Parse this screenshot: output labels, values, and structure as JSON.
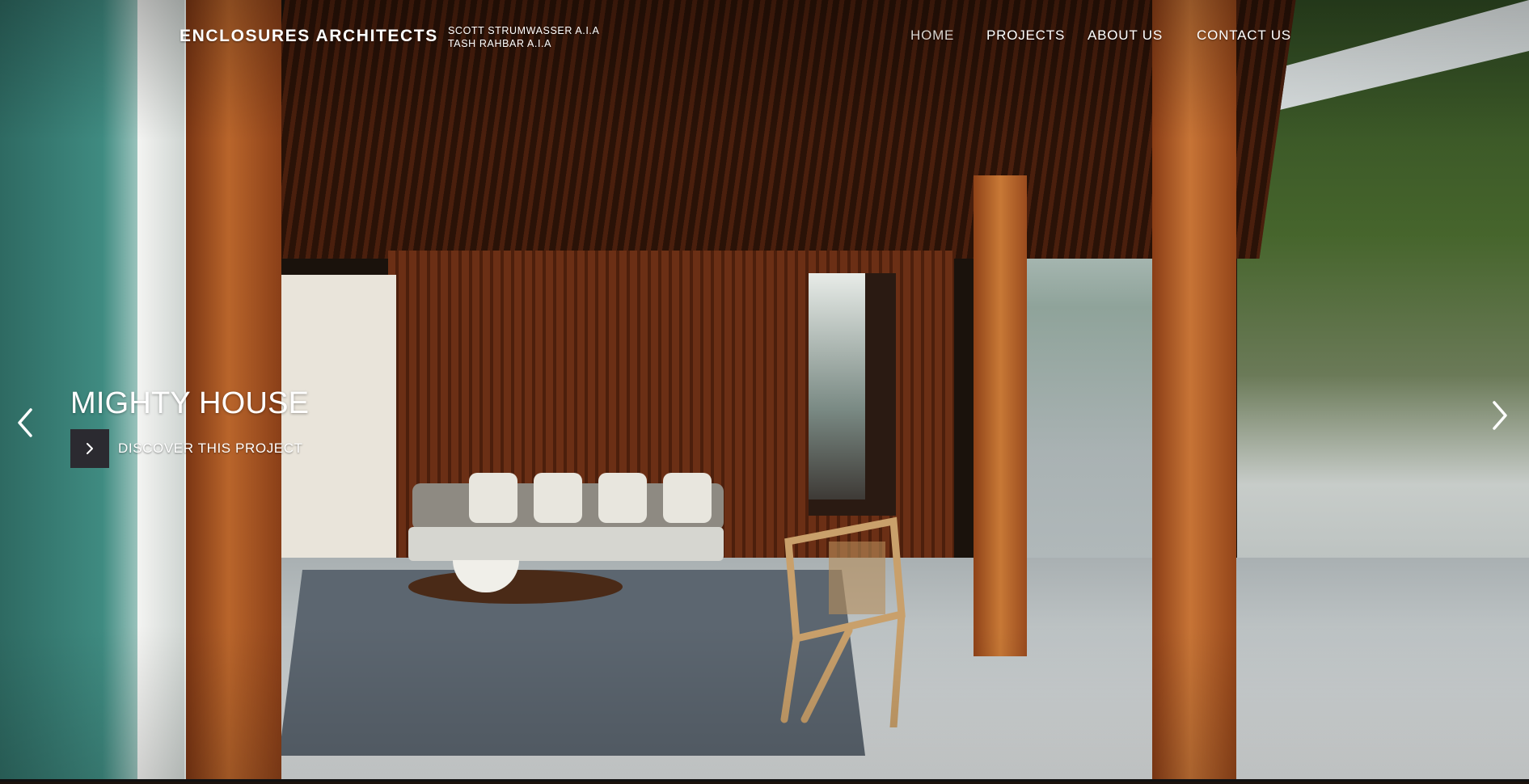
{
  "header": {
    "logo": "ENCLOSURES ARCHITECTS",
    "partners": [
      "SCOTT STRUMWASSER A.I.A",
      "TASH RAHBAR A.I.A"
    ]
  },
  "nav": {
    "items": [
      {
        "label": "HOME",
        "active": true
      },
      {
        "label": "PROJECTS",
        "active": false
      },
      {
        "label": "ABOUT US",
        "active": false
      },
      {
        "label": "CONTACT US",
        "active": false
      }
    ]
  },
  "slide": {
    "title": "MIGHTY HOUSE",
    "cta_label": "DISCOVER THIS PROJECT",
    "cta_icon": "chevron-right-icon",
    "prev_icon": "chevron-left-icon",
    "next_icon": "chevron-right-icon"
  },
  "colors": {
    "cta_background": "#2b2a30",
    "nav_active": "#d9d4cf",
    "text": "#ffffff"
  }
}
